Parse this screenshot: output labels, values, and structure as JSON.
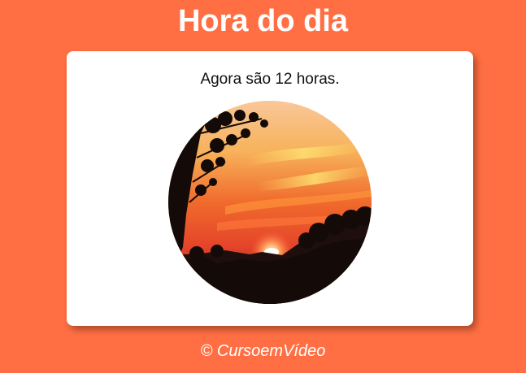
{
  "header": {
    "title": "Hora do dia"
  },
  "card": {
    "message": "Agora são 12 horas.",
    "image": {
      "subject": "sunset-photo",
      "shape": "circle"
    }
  },
  "footer": {
    "text": "© CursoemVídeo"
  },
  "colors": {
    "page_background": "#ff6f43",
    "card_background": "#ffffff",
    "title_text": "#ffffff",
    "message_text": "#111111"
  }
}
